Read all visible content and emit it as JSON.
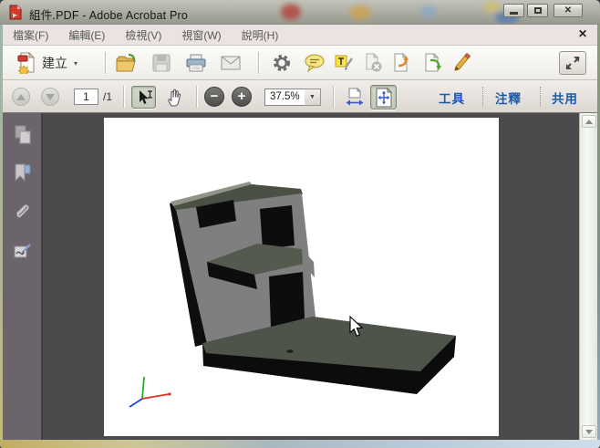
{
  "window": {
    "title": "組件.PDF - Adobe Acrobat Pro"
  },
  "titlebar_controls": {
    "minimize": "minimize",
    "maximize": "maximize",
    "close_glyph": "✕"
  },
  "menubar": {
    "items": [
      "檔案(F)",
      "編輯(E)",
      "檢視(V)",
      "視窗(W)",
      "說明(H)"
    ],
    "close_glyph": "✕"
  },
  "toolbar_main": {
    "create_label": "建立",
    "create_caret": "▾",
    "icon_names": [
      "create-pdf-icon",
      "open-file-icon",
      "save-file-icon",
      "print-icon",
      "email-icon",
      "settings-gear-icon",
      "comment-bubble-icon",
      "text-highlight-icon",
      "delete-page-icon",
      "export-page-icon",
      "convert-page-icon",
      "pencil-icon",
      "expand-arrows-icon"
    ]
  },
  "toolbar_nav": {
    "page_current": "1",
    "page_total_label": "/1",
    "zoom_level": "37.5%",
    "zoom_caret": "▼",
    "minus_glyph": "−",
    "plus_glyph": "+",
    "panel_buttons": [
      "工具",
      "注釋",
      "共用"
    ],
    "icon_names": [
      "page-up-icon",
      "page-down-icon",
      "select-tool-icon",
      "hand-tool-icon",
      "zoom-out-icon",
      "zoom-in-icon",
      "fit-width-icon",
      "fit-page-icon"
    ]
  },
  "sidebar": {
    "icon_names": [
      "page-thumbnails-icon",
      "bookmarks-icon",
      "attachments-icon",
      "signatures-icon"
    ]
  },
  "document": {
    "content": "3d-gray-step-bracket-model",
    "axis_colors": {
      "x": "#e03020",
      "y": "#1db51d",
      "z": "#2040e0"
    },
    "model_colors": {
      "front_face": "#7f7f7f",
      "top_face": "#4b5045",
      "base_top": "#4f544a",
      "shadow": "#0d0d0d"
    }
  },
  "colors": {
    "accent_blue": "#1b5aa5",
    "titlebar": "#a8aaa0",
    "sidebar_bg": "#6b656b",
    "docpane_bg": "#4d4a4d"
  }
}
